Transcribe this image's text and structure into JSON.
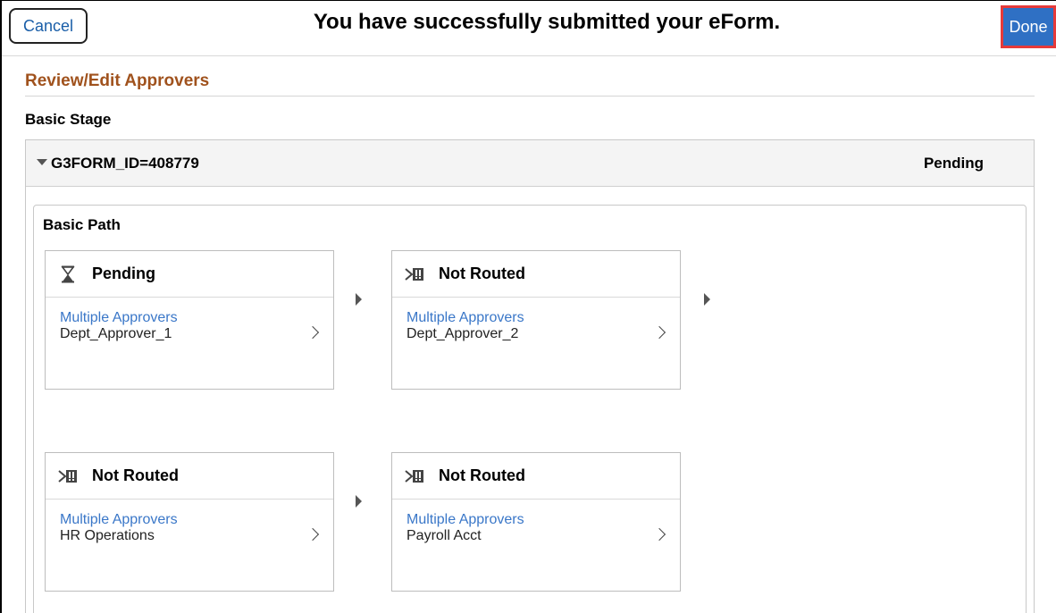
{
  "header": {
    "cancel_label": "Cancel",
    "title": "You have successfully submitted your eForm.",
    "done_label": "Done"
  },
  "review": {
    "section_title": "Review/Edit Approvers",
    "stage_label": "Basic Stage",
    "group": {
      "id_label": "G3FORM_ID=408779",
      "status": "Pending"
    },
    "path": {
      "title": "Basic Path",
      "steps": [
        {
          "status": "Pending",
          "icon": "hourglass-icon",
          "link": "Multiple Approvers",
          "name": "Dept_Approver_1"
        },
        {
          "status": "Not Routed",
          "icon": "not-routed-icon",
          "link": "Multiple Approvers",
          "name": "Dept_Approver_2"
        },
        {
          "status": "Not Routed",
          "icon": "not-routed-icon",
          "link": "Multiple Approvers",
          "name": "HR Operations"
        },
        {
          "status": "Not Routed",
          "icon": "not-routed-icon",
          "link": "Multiple Approvers",
          "name": "Payroll Acct"
        }
      ]
    }
  },
  "colors": {
    "accent": "#2f70c4",
    "section_title": "#a0521d",
    "link": "#3a77c8",
    "done_border": "#e63a3a"
  }
}
